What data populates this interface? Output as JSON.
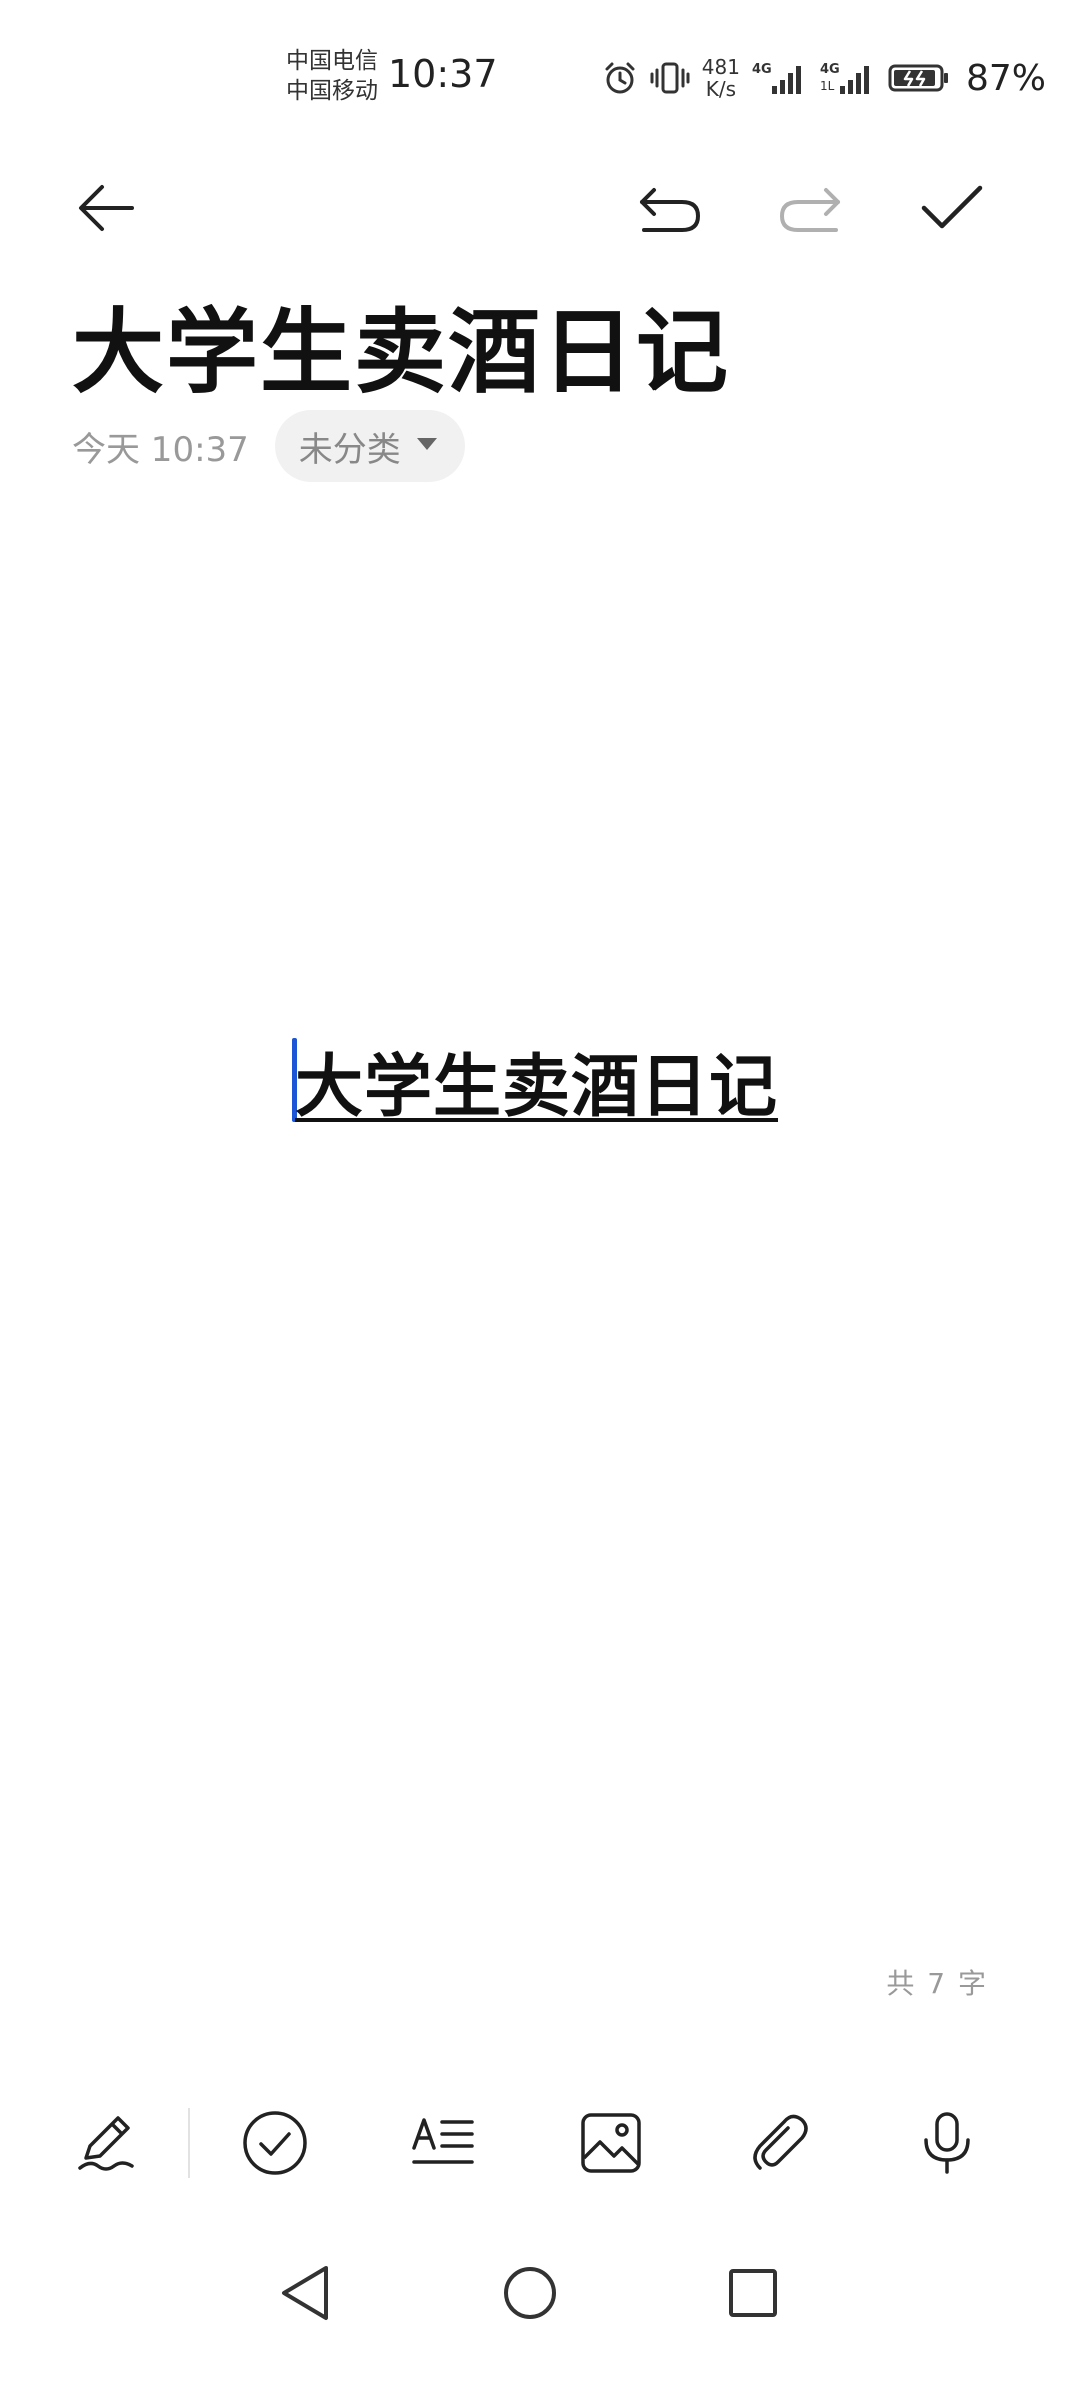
{
  "status_bar": {
    "carrier_1": "中国电信",
    "carrier_2": "中国移动",
    "time": "10:37",
    "net_speed_value": "481",
    "net_speed_unit": "K/s",
    "battery_percent": "87%",
    "icons": [
      "alarm-icon",
      "vibrate-icon",
      "signal-4g-icon",
      "signal-4g-icon",
      "battery-charging-icon"
    ]
  },
  "toolbar": {
    "icons": [
      "back-arrow-icon",
      "undo-icon",
      "redo-icon",
      "check-icon"
    ]
  },
  "note": {
    "title": "大学生卖酒日记",
    "date": "今天 10:37",
    "category": "未分类",
    "body_text": "大学生卖酒日记",
    "word_count": "共 7 字"
  },
  "edit_toolbar": {
    "icons": [
      "handwriting-pen-icon",
      "checklist-icon",
      "text-format-icon",
      "image-icon",
      "attachment-icon",
      "microphone-icon"
    ]
  },
  "system_nav": {
    "icons": [
      "nav-back-icon",
      "nav-home-icon",
      "nav-recents-icon"
    ]
  },
  "colors": {
    "text_primary": "#111111",
    "text_secondary": "#999999",
    "cursor": "#1a56d6",
    "chip_bg": "#f1f1f1",
    "redo_disabled": "#b0b0b0"
  }
}
